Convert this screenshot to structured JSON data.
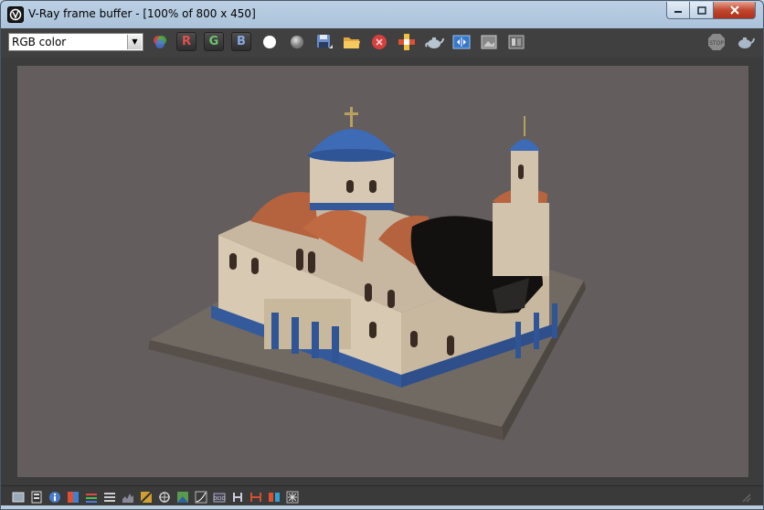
{
  "window": {
    "title": "V-Ray frame buffer - [100% of 800 x 450]"
  },
  "toolbar": {
    "channel_select": "RGB color",
    "r_label": "R",
    "g_label": "G",
    "b_label": "B"
  },
  "colors": {
    "accent_red": "#e05050",
    "accent_green": "#70c070",
    "accent_blue": "#8aa8e0",
    "render_bg": "#635d5d"
  },
  "icons": {
    "toolbar": [
      "color-wheel-icon",
      "red-channel",
      "green-channel",
      "blue-channel",
      "white-circle-icon",
      "grey-circle-icon",
      "save-icon",
      "open-folder-icon",
      "clear-icon",
      "region-render-icon",
      "teapot-render-icon",
      "compare-ab-icon",
      "image-icon",
      "history-icon",
      "stop-icon",
      "render-teapot-icon"
    ],
    "statusbar": [
      "histogram-panel-icon",
      "film-strip-icon",
      "info-icon",
      "color-correction-icon",
      "levels-icon",
      "curves-icon",
      "histogram-icon",
      "exposure-icon",
      "filter-icon",
      "lut-icon",
      "curve-graph-icon",
      "ocio-icon",
      "hue-h-icon",
      "range-icon",
      "stereo-icon",
      "snowflake-icon"
    ]
  }
}
